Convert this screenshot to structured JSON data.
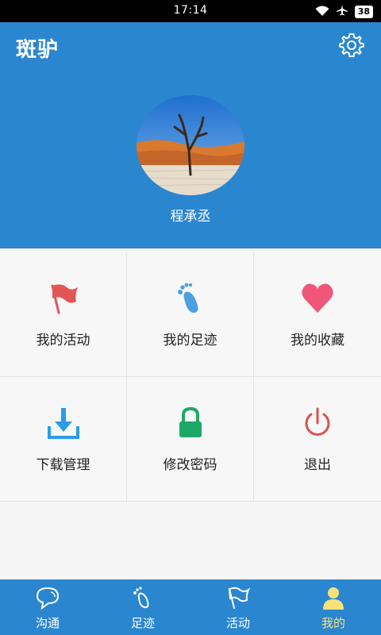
{
  "status": {
    "time": "17:14",
    "battery": "38"
  },
  "header": {
    "logo": "斑驴",
    "username": "程承丞"
  },
  "menu": [
    {
      "label": "我的活动",
      "icon": "red-flag-icon"
    },
    {
      "label": "我的足迹",
      "icon": "footprint-icon"
    },
    {
      "label": "我的收藏",
      "icon": "heart-icon"
    },
    {
      "label": "下载管理",
      "icon": "download-icon"
    },
    {
      "label": "修改密码",
      "icon": "lock-icon"
    },
    {
      "label": "退出",
      "icon": "power-icon"
    }
  ],
  "tabs": [
    {
      "label": "沟通",
      "icon": "chat-bubble-icon"
    },
    {
      "label": "足迹",
      "icon": "footprint-icon"
    },
    {
      "label": "活动",
      "icon": "flag-icon"
    },
    {
      "label": "我的",
      "icon": "person-icon",
      "active": true
    }
  ],
  "colors": {
    "primary": "#2b86d0",
    "active_tab": "#f7e27a"
  }
}
